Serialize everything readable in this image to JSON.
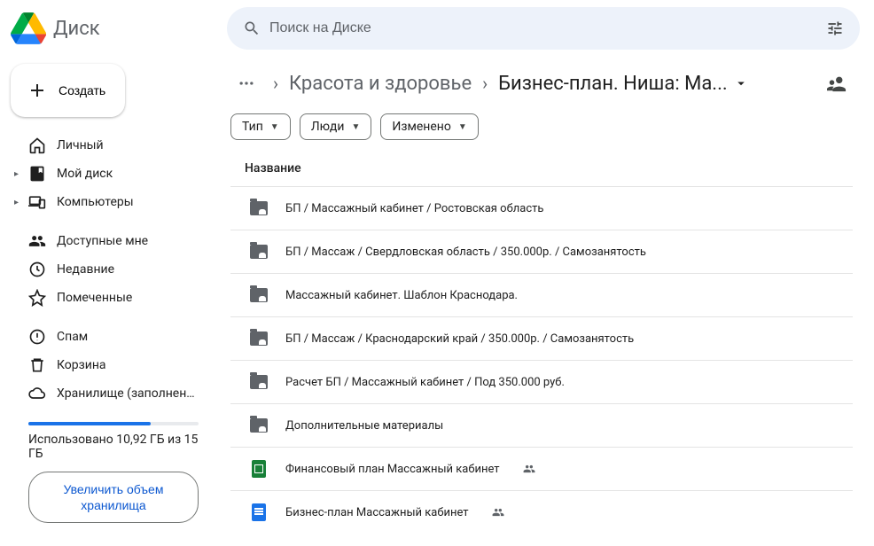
{
  "app_name": "Диск",
  "search": {
    "placeholder": "Поиск на Диске"
  },
  "create_button": "Создать",
  "sidebar": {
    "groups": [
      [
        {
          "label": "Личный",
          "icon": "home"
        },
        {
          "label": "Мой диск",
          "icon": "drive",
          "expandable": true
        },
        {
          "label": "Компьютеры",
          "icon": "devices",
          "expandable": true
        }
      ],
      [
        {
          "label": "Доступные мне",
          "icon": "shared"
        },
        {
          "label": "Недавние",
          "icon": "recent"
        },
        {
          "label": "Помеченные",
          "icon": "star"
        }
      ],
      [
        {
          "label": "Спам",
          "icon": "spam"
        },
        {
          "label": "Корзина",
          "icon": "trash"
        },
        {
          "label": "Хранилище (заполнено ...",
          "icon": "cloud"
        }
      ]
    ],
    "storage_used": "Использовано 10,92 ГБ из 15 ГБ",
    "upgrade": "Увеличить объем хранилища"
  },
  "breadcrumb": {
    "parent": "Красота и здоровье",
    "current": "Бизнес-план. Ниша: Ма..."
  },
  "filters": [
    {
      "label": "Тип"
    },
    {
      "label": "Люди"
    },
    {
      "label": "Изменено"
    }
  ],
  "column_header": "Название",
  "files": [
    {
      "type": "folder-shared",
      "name": "БП / Массажный кабинет / Ростовская область"
    },
    {
      "type": "folder-shared",
      "name": "БП / Массаж / Свердловская область / 350.000р. / Самозанятость"
    },
    {
      "type": "folder-shared",
      "name": "Массажный кабинет. Шаблон Краснодара."
    },
    {
      "type": "folder-shared",
      "name": "БП / Массаж / Краснодарский край / 350.000р. / Самозанятость"
    },
    {
      "type": "folder-shared",
      "name": "Расчет БП / Массажный кабинет / Под 350.000 руб."
    },
    {
      "type": "folder-shared",
      "name": "Дополнительные материалы"
    },
    {
      "type": "sheets",
      "name": "Финансовый план Массажный кабинет",
      "shared": true
    },
    {
      "type": "docs",
      "name": "Бизнес-план Массажный кабинет",
      "shared": true
    }
  ]
}
